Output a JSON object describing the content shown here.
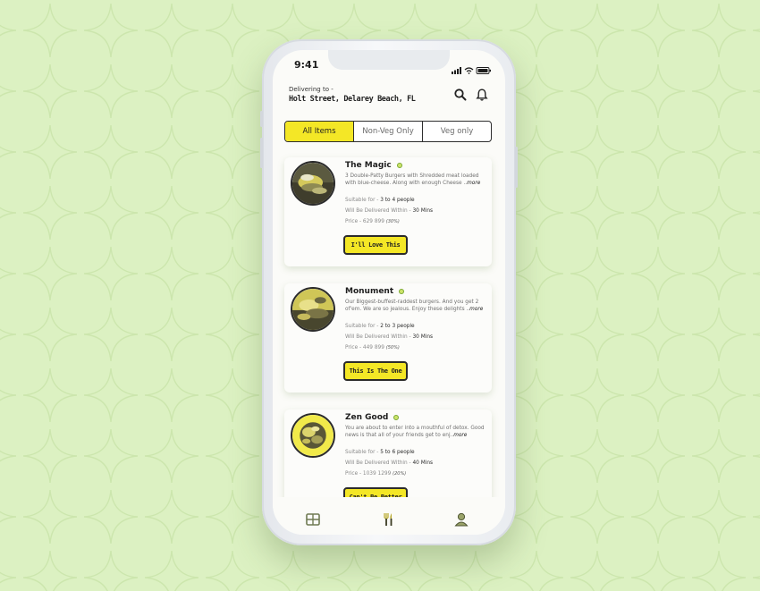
{
  "status_bar": {
    "time": "9:41"
  },
  "header": {
    "delivering_label": "Delivering to -",
    "address": "Holt Street, Delarey Beach, FL",
    "icons": [
      "search-icon",
      "bell-icon"
    ]
  },
  "filters": {
    "tabs": [
      {
        "label": "All Items",
        "active": true
      },
      {
        "label": "Non-Veg Only",
        "active": false
      },
      {
        "label": "Veg only",
        "active": false
      }
    ]
  },
  "items": [
    {
      "name": "The Magic",
      "description": "3 Double-Patty Burgers with Shredded meat loaded with blue-cheese. Along with enough Cheese ..",
      "more": "more",
      "suitable_label": "Suitable for -",
      "suitable_value": "3 to 4 people",
      "delivery_label": "Will Be Delivered Within -",
      "delivery_value": "30 Mins",
      "price_label": "Price -",
      "price_value": "629 899",
      "discount": "(30%)",
      "cta": "I'll Love This"
    },
    {
      "name": "Monument",
      "description": "Our Biggest-buffest-raddest burgers. And you get 2 of'em. We are so jealous. Enjoy these delights ..",
      "more": "more",
      "suitable_label": "Suitable for -",
      "suitable_value": "2 to 3 people",
      "delivery_label": "Will Be Delivered Within -",
      "delivery_value": "30 Mins",
      "price_label": "Price -",
      "price_value": "449 899",
      "discount": "(50%)",
      "cta": "This Is The One"
    },
    {
      "name": "Zen Good",
      "description": "You are about to enter into a mouthful of detox. Good news is that all of your friends get to enj..",
      "more": "more",
      "suitable_label": "Suitable for -",
      "suitable_value": "5 to 6 people",
      "delivery_label": "Will Be Delivered Within -",
      "delivery_value": "40 Mins",
      "price_label": "Price -",
      "price_value": "1039 1299",
      "discount": "(20%)",
      "cta": "Can't Be Better"
    }
  ],
  "bottom_nav": [
    "menu-grid-icon",
    "fork-knife-icon",
    "profile-icon"
  ],
  "colors": {
    "accent": "#f4e726",
    "background": "#dcf1c2",
    "outline": "#2b2b2b"
  }
}
